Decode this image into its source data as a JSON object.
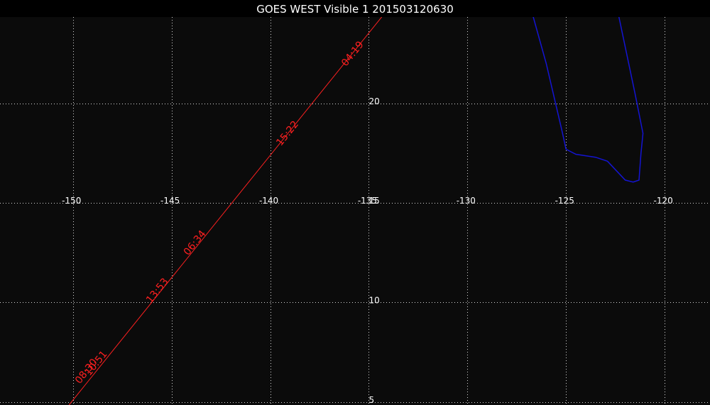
{
  "title": "GOES WEST Visible 1 201503120630",
  "colors": {
    "background": "#0b0b0b",
    "grid": "#d8d8d8",
    "track": "#ff2020",
    "coastline": "#1414d2",
    "text": "#ffffff"
  },
  "map": {
    "lon_range": [
      -153.7,
      -117.7
    ],
    "lat_range": [
      4.85,
      25.2
    ],
    "lon_ticks": [
      -150,
      -145,
      -140,
      -135,
      -130,
      -125,
      -120
    ],
    "lon_tick_labels": [
      "-150",
      "-145",
      "-140",
      "-135",
      "-130",
      "-125",
      "-120"
    ],
    "lat_ticks": [
      5,
      10,
      15,
      20
    ],
    "lat_tick_labels": [
      "5",
      "10",
      "15",
      "20"
    ],
    "grid": true
  },
  "track": {
    "points": [
      {
        "lon": -150.2,
        "lat": 4.85
      },
      {
        "lon": -133.65,
        "lat": 25.2
      }
    ],
    "labels": [
      {
        "text": "04:19",
        "lon": -135.7,
        "lat": 22.4
      },
      {
        "text": "15:22",
        "lon": -139.0,
        "lat": 18.4
      },
      {
        "text": "06:34",
        "lon": -143.7,
        "lat": 12.9
      },
      {
        "text": "13:53",
        "lon": -145.6,
        "lat": 10.5
      },
      {
        "text": "10:51",
        "lon": -148.7,
        "lat": 6.85
      },
      {
        "text": "08:30",
        "lon": -149.2,
        "lat": 6.45
      }
    ]
  },
  "coastline": [
    {
      "lon": -126.9,
      "lat": 25.2
    },
    {
      "lon": -126.0,
      "lat": 22.0
    },
    {
      "lon": -125.2,
      "lat": 18.6
    },
    {
      "lon": -125.0,
      "lat": 17.7
    },
    {
      "lon": -124.5,
      "lat": 17.45
    },
    {
      "lon": -123.5,
      "lat": 17.3
    },
    {
      "lon": -122.9,
      "lat": 17.1
    },
    {
      "lon": -122.0,
      "lat": 16.15
    },
    {
      "lon": -121.6,
      "lat": 16.05
    },
    {
      "lon": -121.3,
      "lat": 16.15
    },
    {
      "lon": -121.2,
      "lat": 17.5
    },
    {
      "lon": -121.1,
      "lat": 18.5
    },
    {
      "lon": -121.5,
      "lat": 20.5
    },
    {
      "lon": -122.5,
      "lat": 25.2
    }
  ]
}
